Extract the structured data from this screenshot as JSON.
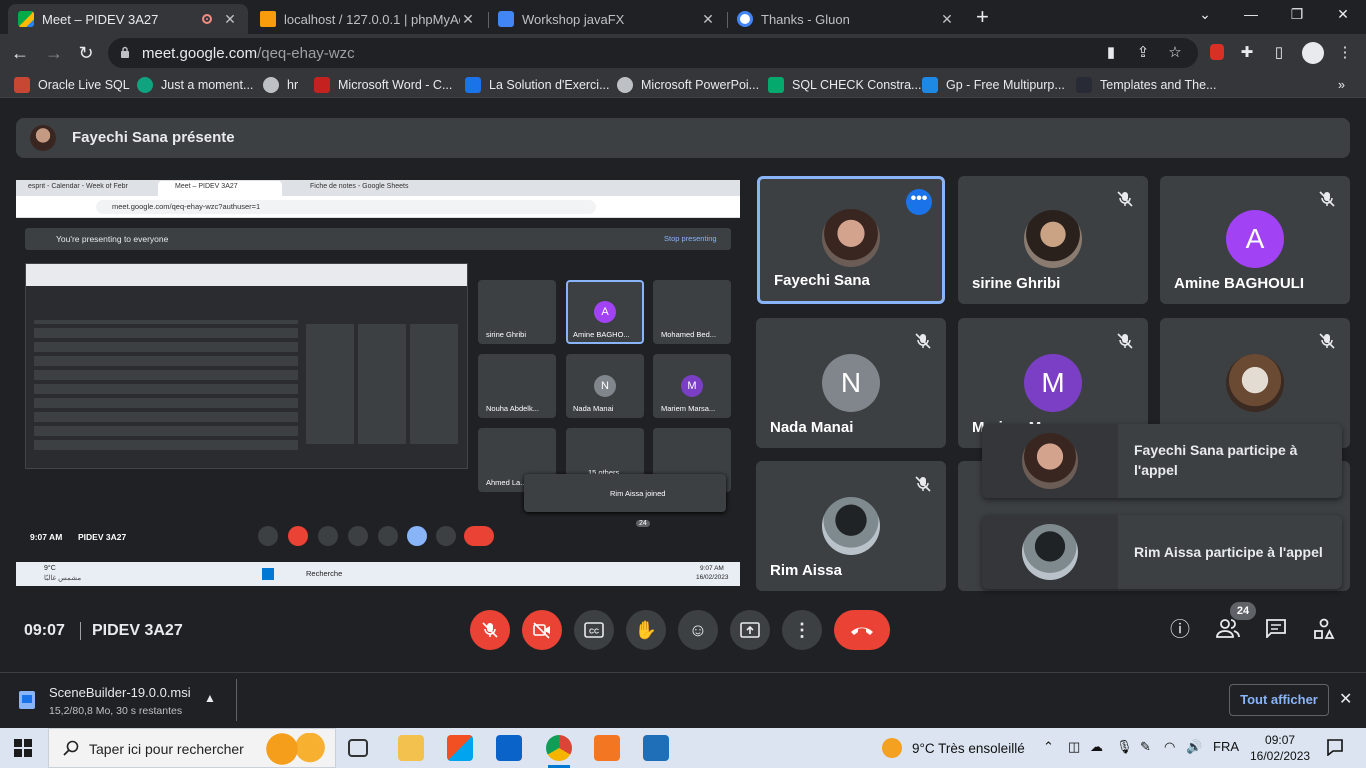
{
  "browser": {
    "tabs": [
      {
        "title": "Meet – PIDEV 3A27",
        "active": true
      },
      {
        "title": "localhost / 127.0.0.1 | phpMyAdm",
        "active": false
      },
      {
        "title": "Workshop javaFX",
        "active": false
      },
      {
        "title": "Thanks - Gluon",
        "active": false
      }
    ],
    "new_tab": "+",
    "url_host": "meet.google.com",
    "url_path": "/qeq-ehay-wzc",
    "bookmarks": [
      "Oracle Live SQL",
      "Just a moment...",
      "hr",
      "Microsoft Word - C...",
      "La Solution d'Exerci...",
      "Microsoft PowerPoi...",
      "SQL CHECK Constra...",
      "Gp - Free Multipurp...",
      "Templates and The..."
    ],
    "overflow": "»"
  },
  "meet": {
    "presenter_banner": "Fayechi Sana présente",
    "shared_screen": {
      "url": "meet.google.com/qeq-ehay-wzc?authuser=1",
      "tabs": [
        "esprit - Calendar - Week of Febr",
        "Meet – PIDEV 3A27",
        "Fiche de notes - Google Sheets"
      ],
      "presenting_msg": "You're presenting to everyone",
      "stop_label": "Stop presenting",
      "tiles": [
        "sirine Ghribi",
        "Amine BAGHO...",
        "Mohamed Bed...",
        "Nouha Abdelk...",
        "Nada Manai",
        "Mariem Marsa...",
        "Ahmed La..."
      ],
      "joined_toast": "Rim Aissa joined",
      "others_label": "15 others",
      "time": "9:07 AM",
      "code": "PIDEV 3A27",
      "count": "24",
      "weather_temp": "9°C",
      "weather_text": "مشمس غالبًا",
      "search": "Recherche",
      "clock_time": "9:07 AM",
      "clock_date": "16/02/2023"
    },
    "participants": [
      {
        "name": "Fayechi Sana",
        "type": "photo",
        "selected": true
      },
      {
        "name": "sirine Ghribi",
        "type": "photo"
      },
      {
        "name": "Amine BAGHOULI",
        "type": "letter",
        "letter": "A",
        "color": "#a142f4"
      },
      {
        "name": "Nada Manai",
        "type": "letter",
        "letter": "N",
        "color": "#80868b"
      },
      {
        "name": "Mariem Marsa",
        "type": "letter",
        "letter": "M",
        "color": "#7b3fc5"
      },
      {
        "name": "Ahmed La",
        "type": "photo"
      },
      {
        "name": "Rim Aissa",
        "type": "photo"
      }
    ],
    "toasts": [
      {
        "text": "Fayechi Sana participe à l'appel"
      },
      {
        "text": "Rim Aissa participe à l'appel"
      }
    ],
    "time": "09:07",
    "meeting_code": "PIDEV 3A27",
    "participant_count": "24"
  },
  "downloads": {
    "file_name": "SceneBuilder-19.0.0.msi",
    "file_status": "15,2/80,8 Mo, 30 s restantes",
    "show_all": "Tout afficher"
  },
  "taskbar": {
    "search_placeholder": "Taper ici pour rechercher",
    "weather": "9°C  Très ensoleillé",
    "language": "FRA",
    "time": "09:07",
    "date": "16/02/2023"
  },
  "colors": {
    "meet_bg": "#202124",
    "tile_bg": "#3c4043",
    "red": "#ea4335",
    "accent": "#8ab4f8"
  }
}
